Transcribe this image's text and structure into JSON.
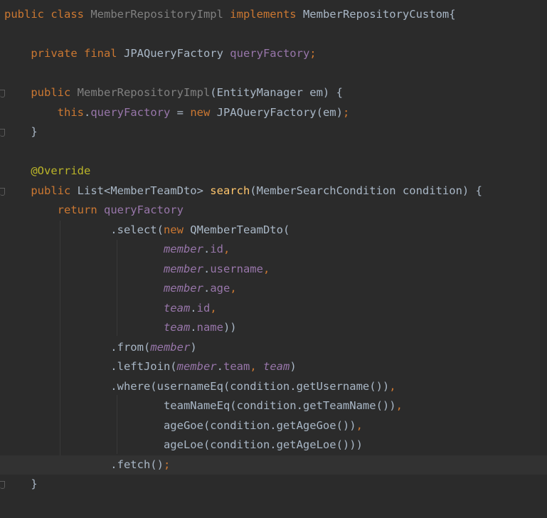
{
  "editor": {
    "lines": [
      {
        "segs": [
          [
            "kw",
            "public class "
          ],
          [
            "gray",
            "MemberRepositoryImpl "
          ],
          [
            "kw",
            "implements "
          ],
          [
            "cls",
            "MemberRepositoryCustom{"
          ]
        ]
      },
      {
        "segs": []
      },
      {
        "segs": [
          [
            "cls",
            "    "
          ],
          [
            "kw",
            "private final "
          ],
          [
            "cls",
            "JPAQueryFactory "
          ],
          [
            "field",
            "queryFactory"
          ],
          [
            "punc",
            ";"
          ]
        ]
      },
      {
        "segs": []
      },
      {
        "segs": [
          [
            "cls",
            "    "
          ],
          [
            "kw",
            "public "
          ],
          [
            "gray",
            "MemberRepositoryImpl"
          ],
          [
            "cls",
            "(EntityManager em) {"
          ]
        ],
        "mark": true
      },
      {
        "segs": [
          [
            "cls",
            "        "
          ],
          [
            "kw",
            "this"
          ],
          [
            "cls",
            "."
          ],
          [
            "field",
            "queryFactory"
          ],
          [
            "cls",
            " = "
          ],
          [
            "kw",
            "new "
          ],
          [
            "cls",
            "JPAQueryFactory(em)"
          ],
          [
            "punc",
            ";"
          ]
        ]
      },
      {
        "segs": [
          [
            "cls",
            "    }"
          ]
        ],
        "mark": true
      },
      {
        "segs": []
      },
      {
        "segs": [
          [
            "cls",
            "    "
          ],
          [
            "ann",
            "@Override"
          ]
        ]
      },
      {
        "segs": [
          [
            "cls",
            "    "
          ],
          [
            "kw",
            "public "
          ],
          [
            "cls",
            "List<MemberTeamDto> "
          ],
          [
            "mdecl",
            "search"
          ],
          [
            "cls",
            "(MemberSearchCondition condition) {"
          ]
        ],
        "mark": true
      },
      {
        "segs": [
          [
            "cls",
            "        "
          ],
          [
            "kw",
            "return "
          ],
          [
            "field",
            "queryFactory"
          ]
        ]
      },
      {
        "segs": [
          [
            "cls",
            "                .select("
          ],
          [
            "kw",
            "new "
          ],
          [
            "cls",
            "QMemberTeamDto("
          ]
        ]
      },
      {
        "segs": [
          [
            "cls",
            "                        "
          ],
          [
            "ifield",
            "member"
          ],
          [
            "cls",
            "."
          ],
          [
            "field",
            "id"
          ],
          [
            "punc",
            ","
          ]
        ]
      },
      {
        "segs": [
          [
            "cls",
            "                        "
          ],
          [
            "ifield",
            "member"
          ],
          [
            "cls",
            "."
          ],
          [
            "field",
            "username"
          ],
          [
            "punc",
            ","
          ]
        ]
      },
      {
        "segs": [
          [
            "cls",
            "                        "
          ],
          [
            "ifield",
            "member"
          ],
          [
            "cls",
            "."
          ],
          [
            "field",
            "age"
          ],
          [
            "punc",
            ","
          ]
        ]
      },
      {
        "segs": [
          [
            "cls",
            "                        "
          ],
          [
            "ifield",
            "team"
          ],
          [
            "cls",
            "."
          ],
          [
            "field",
            "id"
          ],
          [
            "punc",
            ","
          ]
        ]
      },
      {
        "segs": [
          [
            "cls",
            "                        "
          ],
          [
            "ifield",
            "team"
          ],
          [
            "cls",
            "."
          ],
          [
            "field",
            "name"
          ],
          [
            "cls",
            "))"
          ]
        ]
      },
      {
        "segs": [
          [
            "cls",
            "                .from("
          ],
          [
            "ifield",
            "member"
          ],
          [
            "cls",
            ")"
          ]
        ]
      },
      {
        "segs": [
          [
            "cls",
            "                .leftJoin("
          ],
          [
            "ifield",
            "member"
          ],
          [
            "cls",
            "."
          ],
          [
            "field",
            "team"
          ],
          [
            "punc",
            ", "
          ],
          [
            "ifield",
            "team"
          ],
          [
            "cls",
            ")"
          ]
        ]
      },
      {
        "segs": [
          [
            "cls",
            "                .where(usernameEq(condition.getUsername())"
          ],
          [
            "punc",
            ","
          ]
        ]
      },
      {
        "segs": [
          [
            "cls",
            "                        teamNameEq(condition.getTeamName())"
          ],
          [
            "punc",
            ","
          ]
        ]
      },
      {
        "segs": [
          [
            "cls",
            "                        ageGoe(condition.getAgeGoe())"
          ],
          [
            "punc",
            ","
          ]
        ]
      },
      {
        "segs": [
          [
            "cls",
            "                        ageLoe(condition.getAgeLoe()))"
          ]
        ]
      },
      {
        "segs": [
          [
            "cls",
            "                .fetch()"
          ],
          [
            "punc",
            ";"
          ]
        ],
        "current": true
      },
      {
        "segs": [
          [
            "cls",
            "    }"
          ]
        ],
        "mark": true
      },
      {
        "segs": []
      }
    ]
  }
}
